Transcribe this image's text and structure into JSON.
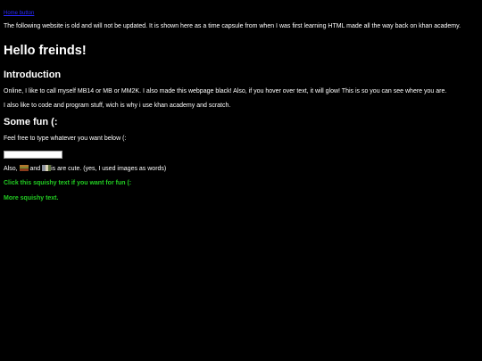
{
  "nav": {
    "home_label": "Home button"
  },
  "notice": "The following website is old and will not be updated. It is shown here as a time capsule from when I was first learning HTML made all the way back on khan academy.",
  "heading": "Hello freinds!",
  "intro": {
    "title": "Introduction",
    "paragraph1": "Online, I like to call myself MB14 or MB or MM2K. I also made this webpage black! Also, if you hover over text, it will glow! This is so you can see where you are.",
    "paragraph2": "I also like to code and program stuff, wich is why i use khan academy and scratch."
  },
  "fun": {
    "title": "Some fun (:",
    "prompt": "Feel free to type whatever you want below (:",
    "input_value": "",
    "cute_prefix": "Also, ",
    "cute_and": " and ",
    "cute_suffix": "is are cute. (yes, I used images as words)",
    "image1_icon": "hamburger-image-icon",
    "image2_icon": "cat-image-icon",
    "squishy1": "Click this squishy text if you want for fun (:",
    "squishy2": "More squishy text."
  },
  "colors": {
    "background": "#000000",
    "text": "#ffffff",
    "link": "#2a2aff",
    "squishy": "#22cc22"
  }
}
